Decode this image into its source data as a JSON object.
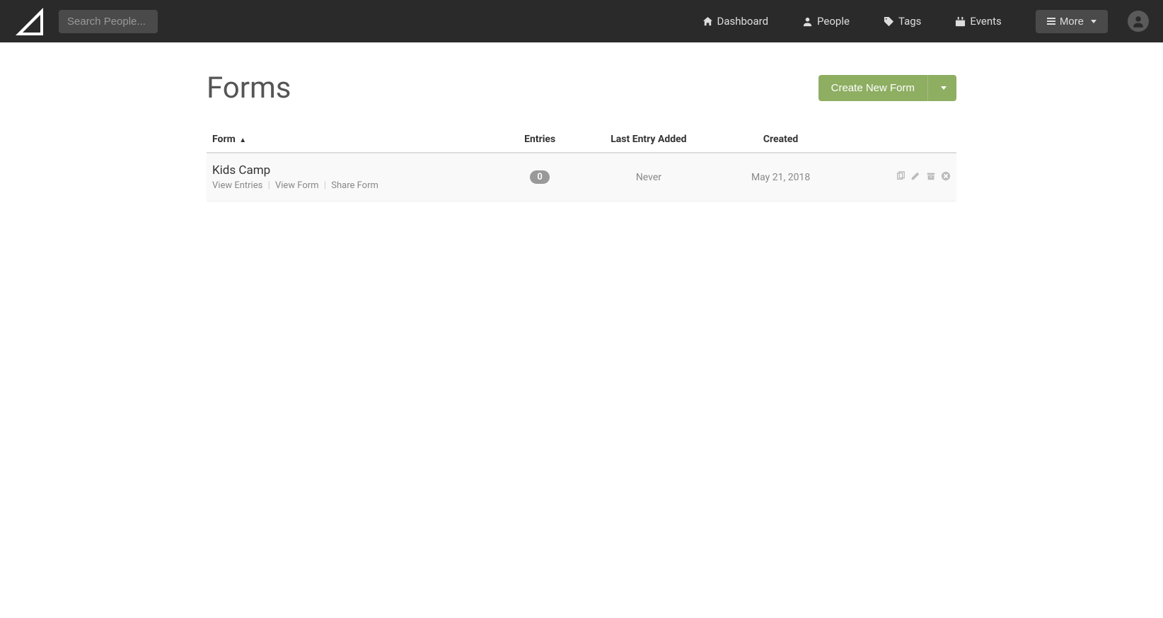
{
  "search": {
    "placeholder": "Search People..."
  },
  "nav": {
    "dashboard": "Dashboard",
    "people": "People",
    "tags": "Tags",
    "events": "Events",
    "more": "More"
  },
  "page": {
    "title": "Forms",
    "create_button": "Create New Form"
  },
  "table": {
    "headers": {
      "form": "Form",
      "entries": "Entries",
      "last_entry": "Last Entry Added",
      "created": "Created"
    }
  },
  "rows": [
    {
      "name": "Kids Camp",
      "view_entries": "View Entries",
      "view_form": "View Form",
      "share_form": "Share Form",
      "entries_count": "0",
      "last_entry": "Never",
      "created": "May 21, 2018"
    }
  ]
}
